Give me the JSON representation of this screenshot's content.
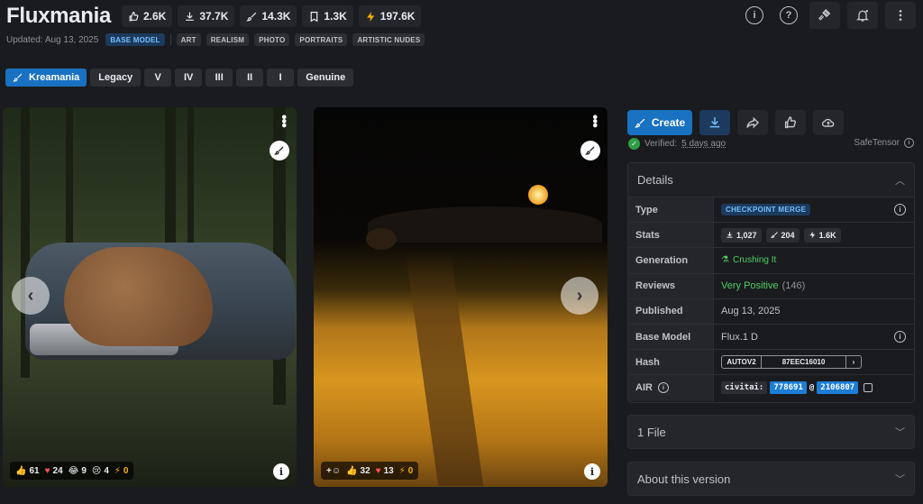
{
  "header": {
    "title": "Fluxmania",
    "stats": {
      "likes": "2.6K",
      "downloads": "37.7K",
      "generations": "14.3K",
      "bookmarks": "1.3K",
      "buzz": "197.6K"
    }
  },
  "meta": {
    "updated": "Updated: Aug 13, 2025",
    "base_tag": "BASE MODEL",
    "tags": [
      "ART",
      "REALISM",
      "PHOTO",
      "PORTRAITS",
      "ARTISTIC NUDES"
    ]
  },
  "versions": [
    "Kreamania",
    "Legacy",
    "V",
    "IV",
    "III",
    "II",
    "I",
    "Genuine"
  ],
  "gallery": [
    {
      "reactions": {
        "like": "61",
        "heart": "24",
        "laugh": "9",
        "cry": "4",
        "buzz": "0"
      }
    },
    {
      "reactions": {
        "like": "32",
        "heart": "13",
        "buzz": "0"
      }
    }
  ],
  "actions": {
    "create_label": "Create"
  },
  "verification": {
    "label": "Verified:",
    "ago": "5 days ago",
    "format": "SafeTensor"
  },
  "details": {
    "heading": "Details",
    "labels": {
      "type": "Type",
      "stats": "Stats",
      "generation": "Generation",
      "reviews": "Reviews",
      "published": "Published",
      "base_model": "Base Model",
      "hash": "Hash",
      "air": "AIR"
    },
    "type": "CHECKPOINT MERGE",
    "stats": {
      "downloads": "1,027",
      "generations": "204",
      "buzz": "1.6K"
    },
    "generation": "Crushing It",
    "reviews": {
      "rating": "Very Positive",
      "count": "(146)"
    },
    "published": "Aug 13, 2025",
    "base_model": "Flux.1 D",
    "hash": {
      "type": "AUTOV2",
      "value": "87EEC16010",
      "arrow": "›"
    },
    "air": {
      "prefix": "civitai:",
      "model_id": "778691",
      "at": "@",
      "version_id": "2106807"
    }
  },
  "sections": {
    "files": "1 File",
    "about": "About this version"
  },
  "colors": {
    "background": "#1a1b1e",
    "accent": "#1971c2",
    "positive": "#51cf66",
    "buzz": "#fab005"
  }
}
